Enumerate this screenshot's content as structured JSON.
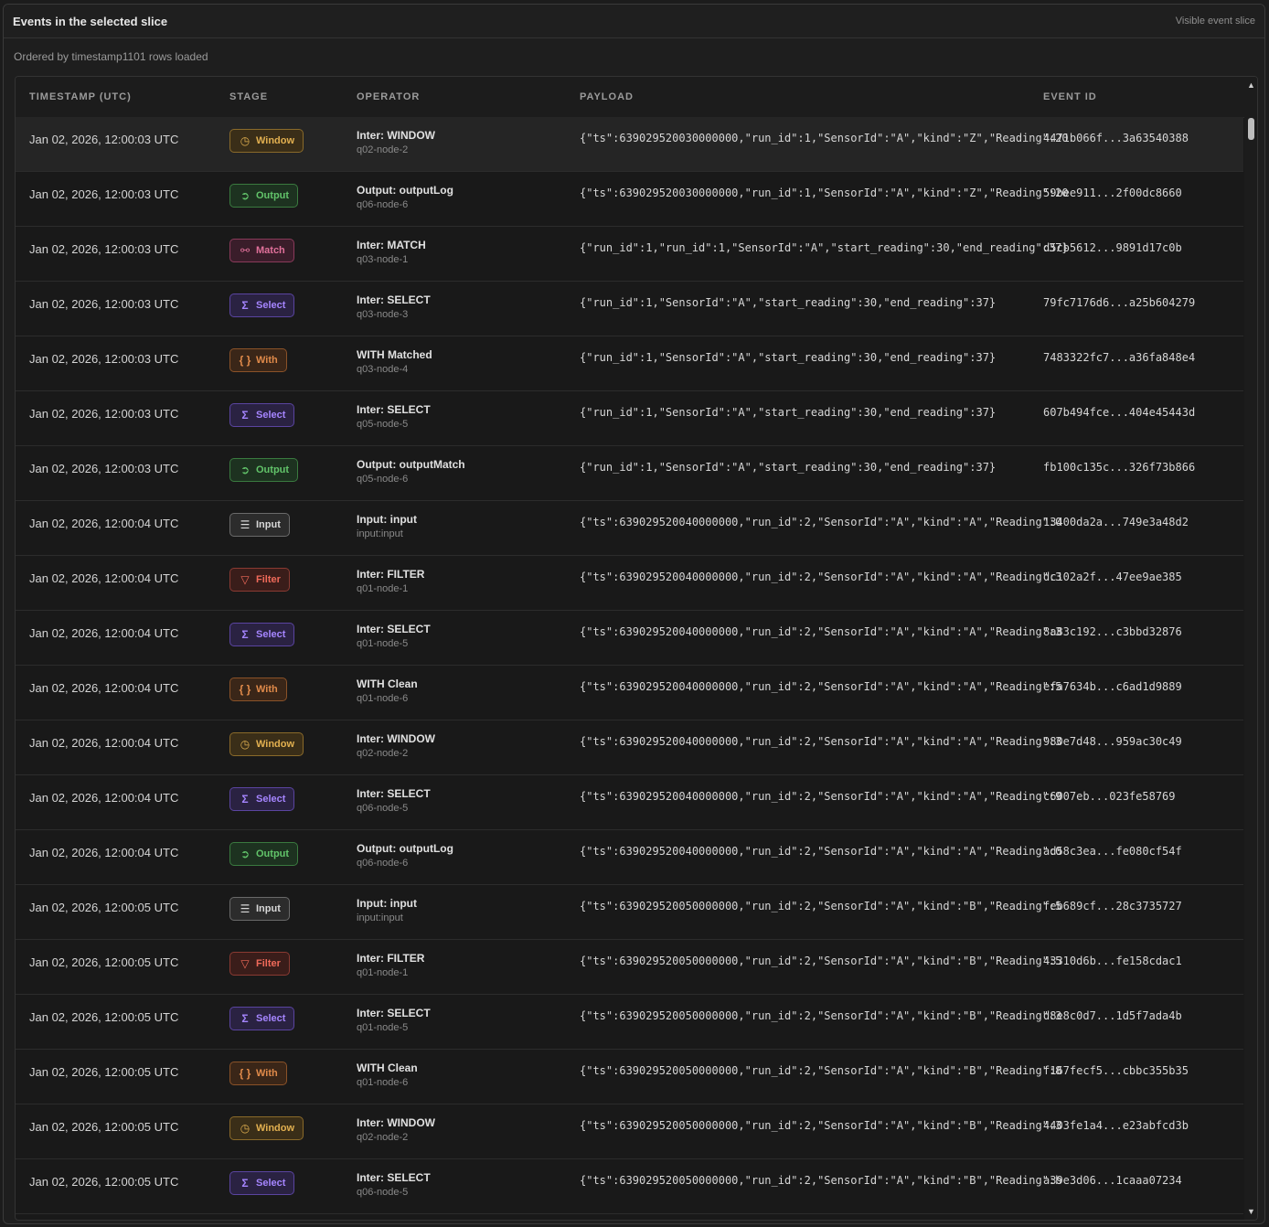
{
  "header": {
    "title": "Events in the selected slice",
    "tag": "Visible event slice"
  },
  "subline": "Ordered by timestamp1101 rows loaded",
  "columns": {
    "ts": "Timestamp (UTC)",
    "stage": "Stage",
    "operator": "Operator",
    "payload": "Payload",
    "event_id": "Event ID"
  },
  "colors": {
    "window": "#e2b050",
    "output": "#62c46a",
    "match": "#e0709a",
    "select": "#a585ff",
    "with": "#e08a4a",
    "input": "#d8d8d8",
    "filter": "#f06a5a"
  },
  "rows": [
    {
      "ts": "Jan 02, 2026, 12:00:03 UTC",
      "stage": "Window",
      "stage_icon": "clock-icon",
      "op": "Inter: WINDOW",
      "node": "q02-node-2",
      "payload": "{\"ts\":639029520030000000,\"run_id\":1,\"SensorId\":\"A\",\"kind\":\"Z\",\"Reading\":20",
      "id": "4471b066f...3a63540388"
    },
    {
      "ts": "Jan 02, 2026, 12:00:03 UTC",
      "stage": "Output",
      "stage_icon": "arrow-circle-icon",
      "op": "Output: outputLog",
      "node": "q06-node-6",
      "payload": "{\"ts\":639029520030000000,\"run_id\":1,\"SensorId\":\"A\",\"kind\":\"Z\",\"Reading\":20",
      "id": "59bee911...2f00dc8660"
    },
    {
      "ts": "Jan 02, 2026, 12:00:03 UTC",
      "stage": "Match",
      "stage_icon": "match-icon",
      "op": "Inter: MATCH",
      "node": "q03-node-1",
      "payload": "{\"run_id\":1,\"run_id\":1,\"SensorId\":\"A\",\"start_reading\":30,\"end_reading\":37}",
      "id": "d5cb5612...9891d17c0b"
    },
    {
      "ts": "Jan 02, 2026, 12:00:03 UTC",
      "stage": "Select",
      "stage_icon": "sigma-icon",
      "op": "Inter: SELECT",
      "node": "q03-node-3",
      "payload": "{\"run_id\":1,\"SensorId\":\"A\",\"start_reading\":30,\"end_reading\":37}",
      "id": "79fc7176d6...a25b604279"
    },
    {
      "ts": "Jan 02, 2026, 12:00:03 UTC",
      "stage": "With",
      "stage_icon": "braces-icon",
      "op": "WITH Matched",
      "node": "q03-node-4",
      "payload": "{\"run_id\":1,\"SensorId\":\"A\",\"start_reading\":30,\"end_reading\":37}",
      "id": "7483322fc7...a36fa848e4"
    },
    {
      "ts": "Jan 02, 2026, 12:00:03 UTC",
      "stage": "Select",
      "stage_icon": "sigma-icon",
      "op": "Inter: SELECT",
      "node": "q05-node-5",
      "payload": "{\"run_id\":1,\"SensorId\":\"A\",\"start_reading\":30,\"end_reading\":37}",
      "id": "607b494fce...404e45443d"
    },
    {
      "ts": "Jan 02, 2026, 12:00:03 UTC",
      "stage": "Output",
      "stage_icon": "arrow-circle-icon",
      "op": "Output: outputMatch",
      "node": "q05-node-6",
      "payload": "{\"run_id\":1,\"SensorId\":\"A\",\"start_reading\":30,\"end_reading\":37}",
      "id": "fb100c135c...326f73b866"
    },
    {
      "ts": "Jan 02, 2026, 12:00:04 UTC",
      "stage": "Input",
      "stage_icon": "database-icon",
      "op": "Input: input",
      "node": "input:input",
      "payload": "{\"ts\":639029520040000000,\"run_id\":2,\"SensorId\":\"A\",\"kind\":\"A\",\"Reading\":0",
      "id": "13400da2a...749e3a48d2"
    },
    {
      "ts": "Jan 02, 2026, 12:00:04 UTC",
      "stage": "Filter",
      "stage_icon": "funnel-icon",
      "op": "Inter: FILTER",
      "node": "q01-node-1",
      "payload": "{\"ts\":639029520040000000,\"run_id\":2,\"SensorId\":\"A\",\"kind\":\"A\",\"Reading\":3",
      "id": "dc102a2f...47ee9ae385"
    },
    {
      "ts": "Jan 02, 2026, 12:00:04 UTC",
      "stage": "Select",
      "stage_icon": "sigma-icon",
      "op": "Inter: SELECT",
      "node": "q01-node-5",
      "payload": "{\"ts\":639029520040000000,\"run_id\":2,\"SensorId\":\"A\",\"kind\":\"A\",\"Reading\":3",
      "id": "8a83c192...c3bbd32876"
    },
    {
      "ts": "Jan 02, 2026, 12:00:04 UTC",
      "stage": "With",
      "stage_icon": "braces-icon",
      "op": "WITH Clean",
      "node": "q01-node-6",
      "payload": "{\"ts\":639029520040000000,\"run_id\":2,\"SensorId\":\"A\",\"kind\":\"A\",\"Reading\":5",
      "id": "efa7634b...c6ad1d9889"
    },
    {
      "ts": "Jan 02, 2026, 12:00:04 UTC",
      "stage": "Window",
      "stage_icon": "clock-icon",
      "op": "Inter: WINDOW",
      "node": "q02-node-2",
      "payload": "{\"ts\":639029520040000000,\"run_id\":2,\"SensorId\":\"A\",\"kind\":\"A\",\"Reading\":3",
      "id": "980e7d48...959ac30c49"
    },
    {
      "ts": "Jan 02, 2026, 12:00:04 UTC",
      "stage": "Select",
      "stage_icon": "sigma-icon",
      "op": "Inter: SELECT",
      "node": "q06-node-5",
      "payload": "{\"ts\":639029520040000000,\"run_id\":2,\"SensorId\":\"A\",\"kind\":\"A\",\"Reading\":9",
      "id": "c6007eb...023fe58769"
    },
    {
      "ts": "Jan 02, 2026, 12:00:04 UTC",
      "stage": "Output",
      "stage_icon": "arrow-circle-icon",
      "op": "Output: outputLog",
      "node": "q06-node-6",
      "payload": "{\"ts\":639029520040000000,\"run_id\":2,\"SensorId\":\"A\",\"kind\":\"A\",\"Reading\":0",
      "id": "ad58c3ea...fe080cf54f"
    },
    {
      "ts": "Jan 02, 2026, 12:00:05 UTC",
      "stage": "Input",
      "stage_icon": "database-icon",
      "op": "Input: input",
      "node": "input:input",
      "payload": "{\"ts\":639029520050000000,\"run_id\":2,\"SensorId\":\"A\",\"kind\":\"B\",\"Reading\":5",
      "id": "feb689cf...28c3735727"
    },
    {
      "ts": "Jan 02, 2026, 12:00:05 UTC",
      "stage": "Filter",
      "stage_icon": "funnel-icon",
      "op": "Inter: FILTER",
      "node": "q01-node-1",
      "payload": "{\"ts\":639029520050000000,\"run_id\":2,\"SensorId\":\"A\",\"kind\":\"B\",\"Reading\":5",
      "id": "43310d6b...fe158cdac1"
    },
    {
      "ts": "Jan 02, 2026, 12:00:05 UTC",
      "stage": "Select",
      "stage_icon": "sigma-icon",
      "op": "Inter: SELECT",
      "node": "q01-node-5",
      "payload": "{\"ts\":639029520050000000,\"run_id\":2,\"SensorId\":\"A\",\"kind\":\"B\",\"Reading\":3",
      "id": "d8e8c0d7...1d5f7ada4b"
    },
    {
      "ts": "Jan 02, 2026, 12:00:05 UTC",
      "stage": "With",
      "stage_icon": "braces-icon",
      "op": "WITH Clean",
      "node": "q01-node-6",
      "payload": "{\"ts\":639029520050000000,\"run_id\":2,\"SensorId\":\"A\",\"kind\":\"B\",\"Reading\":8",
      "id": "f167fecf5...cbbc355b35"
    },
    {
      "ts": "Jan 02, 2026, 12:00:05 UTC",
      "stage": "Window",
      "stage_icon": "clock-icon",
      "op": "Inter: WINDOW",
      "node": "q02-node-2",
      "payload": "{\"ts\":639029520050000000,\"run_id\":2,\"SensorId\":\"A\",\"kind\":\"B\",\"Reading\":3",
      "id": "4403fe1a4...e23abfcd3b"
    },
    {
      "ts": "Jan 02, 2026, 12:00:05 UTC",
      "stage": "Select",
      "stage_icon": "sigma-icon",
      "op": "Inter: SELECT",
      "node": "q06-node-5",
      "payload": "{\"ts\":639029520050000000,\"run_id\":2,\"SensorId\":\"A\",\"kind\":\"B\",\"Reading\":b",
      "id": "a39e3d06...1caaa07234"
    }
  ]
}
